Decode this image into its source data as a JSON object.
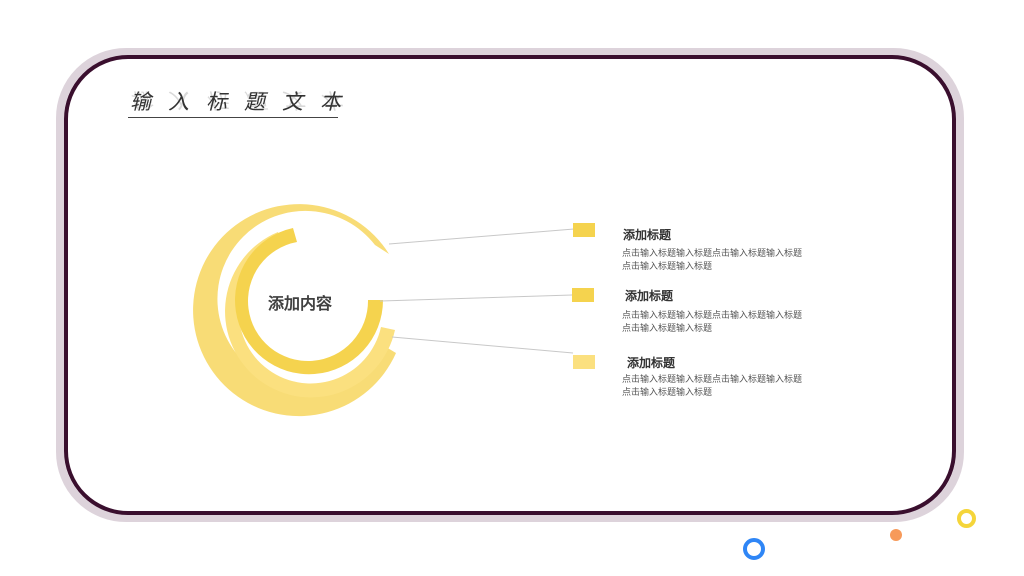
{
  "slide": {
    "title": "输入标题文本",
    "center_label": "添加内容",
    "items": [
      {
        "title": "添加标题",
        "text": "点击输入标题输入标题点击输入标题输入标题点击输入标题输入标题"
      },
      {
        "title": "添加标题",
        "text": "点击输入标题输入标题点击输入标题输入标题点击输入标题输入标题"
      },
      {
        "title": "添加标题",
        "text": "点击输入标题输入标题点击输入标题输入标题点击输入标题输入标题"
      }
    ]
  },
  "colors": {
    "frame": "#3a0f2e",
    "ring_outer": "#f8dc76",
    "ring_middle": "#fbe07f",
    "ring_inner": "#f5d34e",
    "deco_blue": "#2f86f6",
    "deco_orange": "#f79a5a",
    "deco_yellow": "#f5d53a"
  }
}
